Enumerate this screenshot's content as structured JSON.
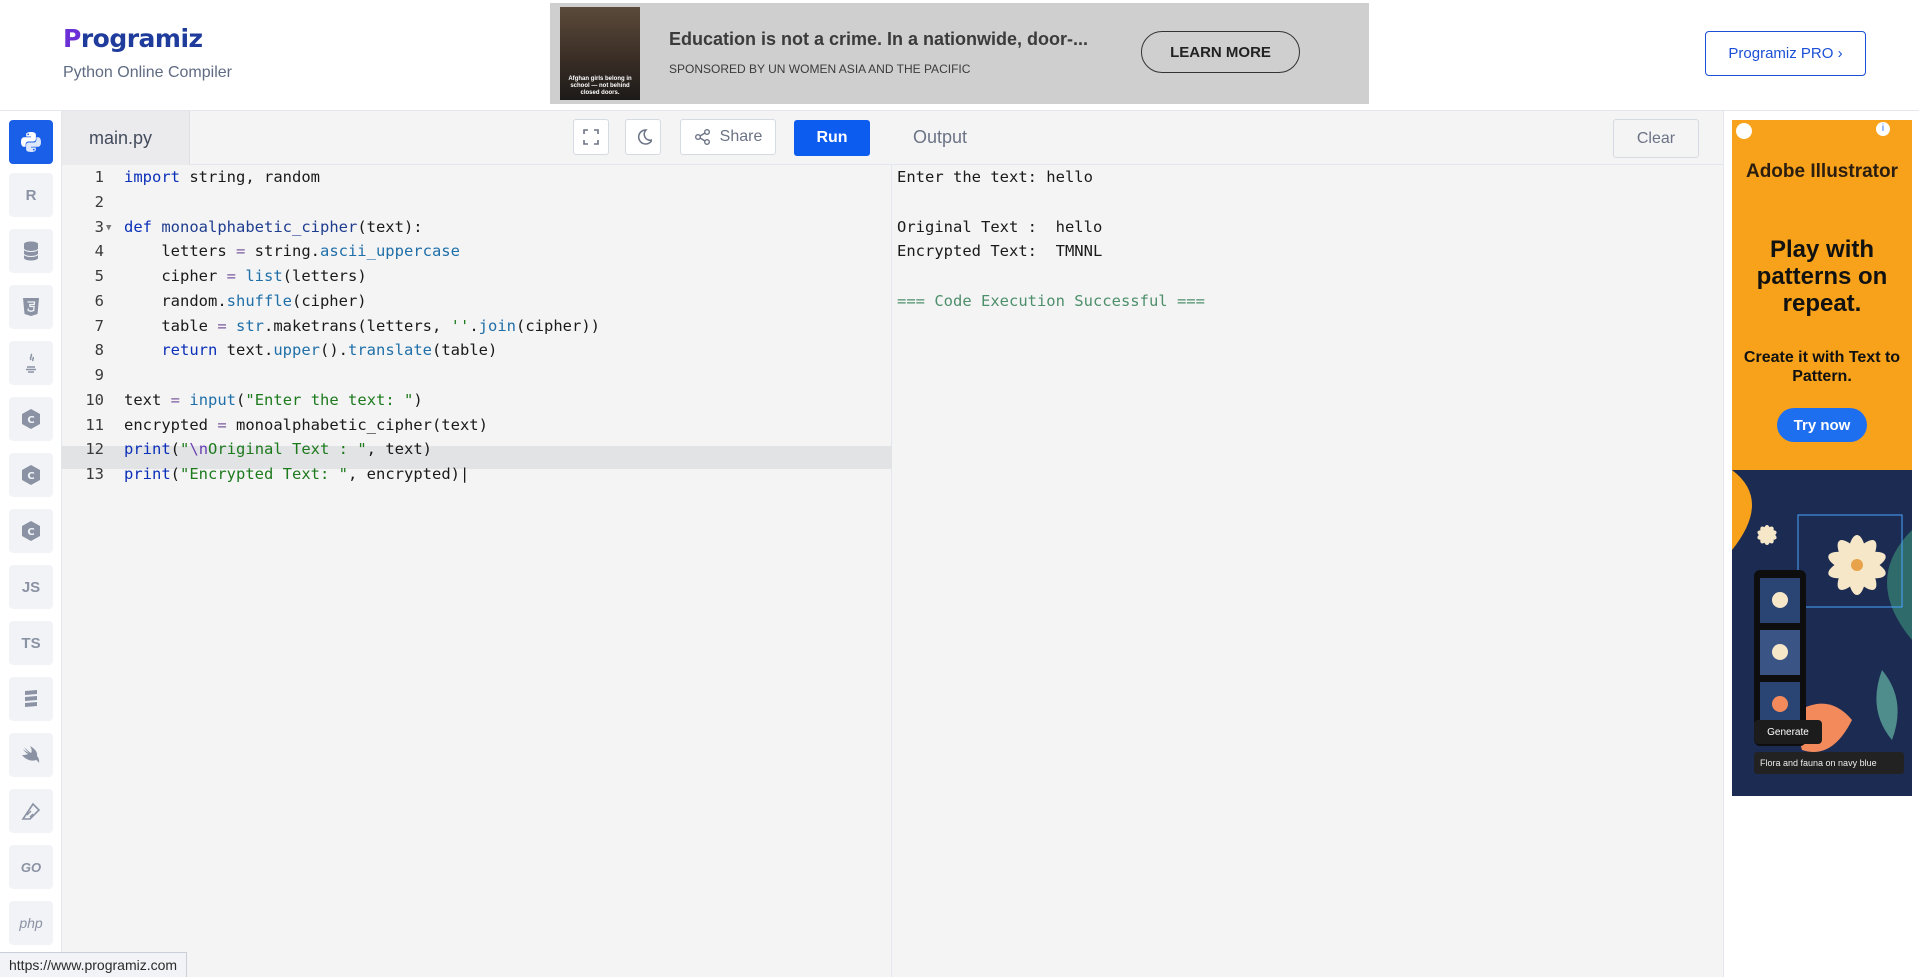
{
  "header": {
    "logo_text": "rogramiz",
    "logo_p": "P",
    "subtitle": "Python Online Compiler",
    "pro_button": "Programiz PRO ›"
  },
  "ad_banner": {
    "title": "Education is not a crime. In a nationwide, door-...",
    "sponsor": "SPONSORED BY UN WOMEN ASIA AND THE PACIFIC",
    "button": "LEARN MORE",
    "thumb_caption": "Afghan girls belong in school — not behind closed doors."
  },
  "sidebar": {
    "items": [
      {
        "name": "python",
        "label": "",
        "active": true
      },
      {
        "name": "r",
        "label": "R"
      },
      {
        "name": "sql",
        "label": ""
      },
      {
        "name": "html",
        "label": "5"
      },
      {
        "name": "java",
        "label": ""
      },
      {
        "name": "c",
        "label": "C"
      },
      {
        "name": "cpp",
        "label": "C"
      },
      {
        "name": "csharp",
        "label": "C"
      },
      {
        "name": "js",
        "label": "JS"
      },
      {
        "name": "ts",
        "label": "TS"
      },
      {
        "name": "go-stack",
        "label": ""
      },
      {
        "name": "swift",
        "label": ""
      },
      {
        "name": "rust",
        "label": ""
      },
      {
        "name": "go",
        "label": "GO"
      },
      {
        "name": "php",
        "label": "php"
      }
    ]
  },
  "editor": {
    "filename": "main.py",
    "share_label": "Share",
    "run_label": "Run",
    "lines": [
      "1",
      "2",
      "3",
      "4",
      "5",
      "6",
      "7",
      "8",
      "9",
      "10",
      "11",
      "12",
      "13"
    ]
  },
  "output": {
    "title": "Output",
    "clear_label": "Clear",
    "lines": [
      "Enter the text: hello",
      "",
      "Original Text :  hello",
      "Encrypted Text:  TMNNL",
      "",
      "=== Code Execution Successful ==="
    ]
  },
  "side_ad": {
    "brand": "Adobe Illustrator",
    "headline": "Play with patterns on repeat.",
    "subline": "Create it with Text to Pattern.",
    "button": "Try now",
    "generate": "Generate",
    "prompt": "Flora and fauna on navy blue"
  },
  "status_bar": {
    "url": "https://www.programiz.com"
  }
}
